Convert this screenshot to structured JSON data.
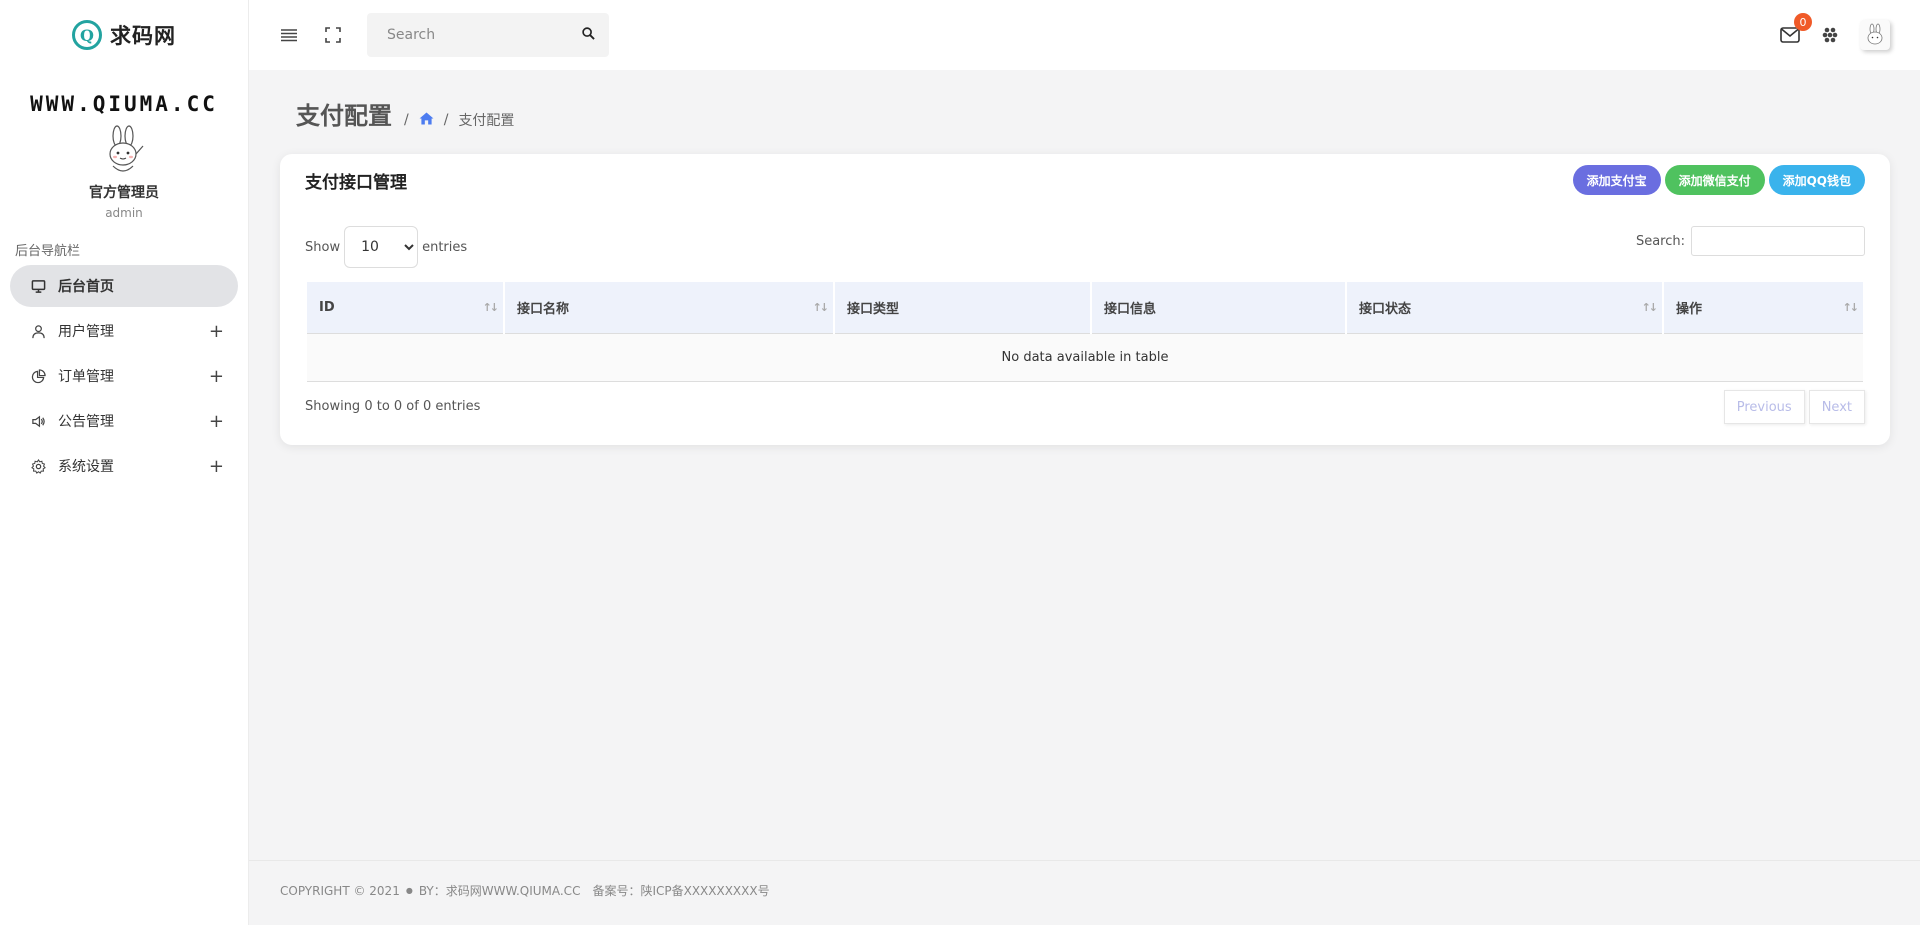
{
  "sidebar": {
    "logo_text": "求码网",
    "brand_url": "WWW.QIUMA.CC",
    "profile_name": "官方管理员",
    "profile_role": "admin",
    "nav_heading": "后台导航栏",
    "items": [
      {
        "label": "后台首页",
        "icon": "monitor-icon",
        "active": true
      },
      {
        "label": "用户管理",
        "icon": "user-icon",
        "expandable": true
      },
      {
        "label": "订单管理",
        "icon": "pie-chart-icon",
        "expandable": true
      },
      {
        "label": "公告管理",
        "icon": "speaker-icon",
        "expandable": true
      },
      {
        "label": "系统设置",
        "icon": "gear-icon",
        "expandable": true
      }
    ]
  },
  "topbar": {
    "search_placeholder": "Search",
    "mail_count": "0"
  },
  "page": {
    "title": "支付配置",
    "crumb_sep": "/",
    "crumb_current": "支付配置"
  },
  "card": {
    "title": "支付接口管理",
    "buttons": {
      "alipay": "添加支付宝",
      "wechat": "添加微信支付",
      "qq": "添加QQ钱包"
    },
    "length_show": "Show",
    "length_value": "10",
    "length_entries": "entries",
    "search_label": "Search:",
    "columns": [
      "ID",
      "接口名称",
      "接口类型",
      "接口信息",
      "接口状态",
      "操作"
    ],
    "empty_text": "No data available in table",
    "info": "Showing 0 to 0 of 0 entries",
    "prev": "Previous",
    "next": "Next"
  },
  "footer": {
    "copyright": "COPYRIGHT © 2021",
    "by": "BY：求码网WWW.QIUMA.CC",
    "icp": "备案号：陕ICP备XXXXXXXXX号"
  },
  "colors": {
    "accent": "#4d7cf0",
    "alipay": "#6a6ee0",
    "wechat": "#4fc25f",
    "qq": "#3ab3ec",
    "badge": "#f05a28"
  }
}
